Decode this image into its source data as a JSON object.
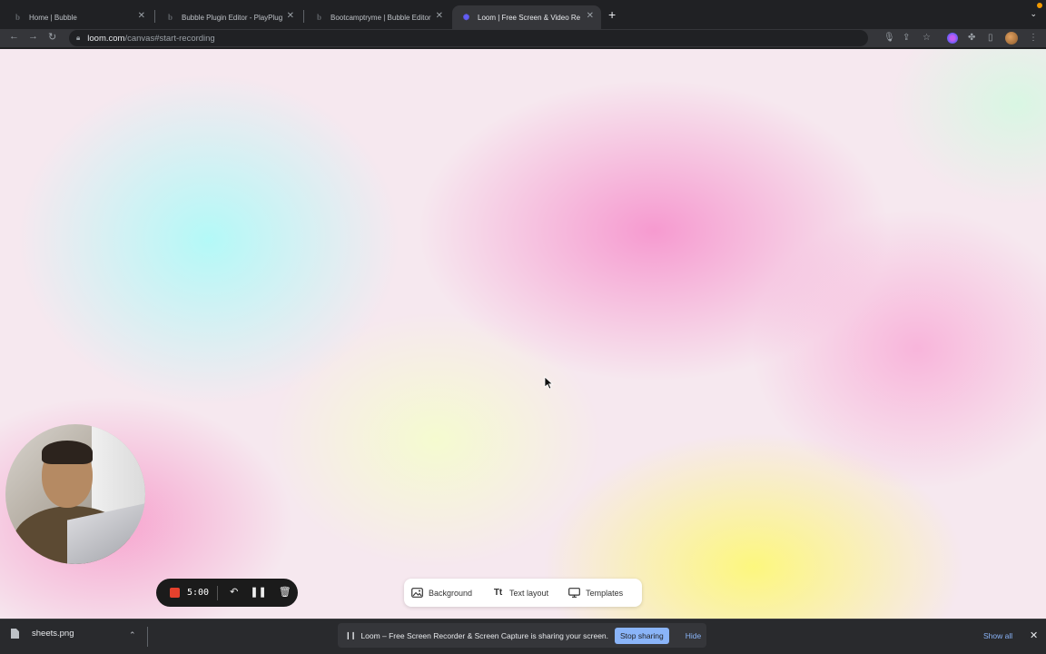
{
  "browser": {
    "tabs": [
      {
        "title": "Home | Bubble",
        "favicon": "bubble-logo-icon",
        "active": false
      },
      {
        "title": "Bubble Plugin Editor - PlayPlug",
        "favicon": "bubble-logo-icon",
        "active": false
      },
      {
        "title": "Bootcamptryme | Bubble Editor",
        "favicon": "bubble-logo-icon",
        "active": false
      },
      {
        "title": "Loom | Free Screen & Video Re",
        "favicon": "loom-logo-icon",
        "active": true
      }
    ],
    "url": {
      "host": "loom.com",
      "path": "/canvas#start-recording"
    }
  },
  "recorder": {
    "timer": "5:00"
  },
  "canvas_toolbar": {
    "items": [
      {
        "label": "Background",
        "icon": "image-icon"
      },
      {
        "label": "Text layout",
        "icon": "text-icon"
      },
      {
        "label": "Templates",
        "icon": "monitor-icon"
      }
    ]
  },
  "sharing_banner": {
    "message": "Loom – Free Screen Recorder & Screen Capture is sharing your screen.",
    "stop_label": "Stop sharing",
    "hide_label": "Hide"
  },
  "downloads": {
    "file": "sheets.png",
    "show_all": "Show all"
  },
  "colors": {
    "stop_red": "#e5412d",
    "loom_purple": "#625df5",
    "link_blue": "#8ab4f8"
  }
}
